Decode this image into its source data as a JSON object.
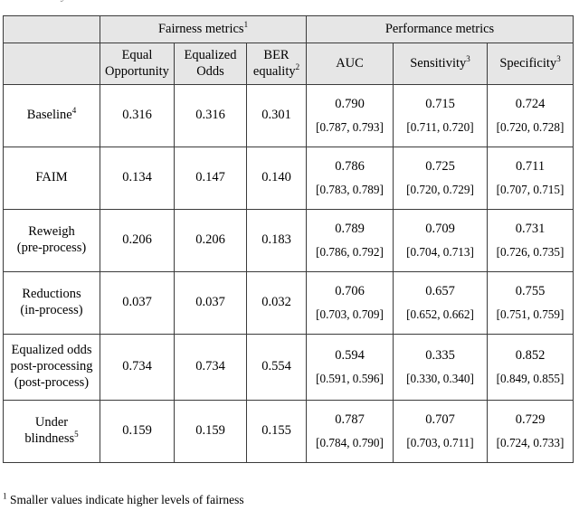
{
  "page": {
    "clipped_text_above": "y",
    "footnote": {
      "marker": "1",
      "text": "Smaller values indicate higher levels of fairness"
    },
    "colors": {
      "header_fill": "#e6e6e6",
      "border": "#3b3b3b",
      "text": "#000000",
      "background": "#ffffff"
    }
  },
  "table": {
    "group_headers": [
      {
        "label": "",
        "marker": ""
      },
      {
        "label": "Fairness metrics",
        "marker": "1",
        "span": 3
      },
      {
        "label": "Performance metrics",
        "marker": "",
        "span": 3
      }
    ],
    "column_headers": [
      {
        "line1": "",
        "line2": "",
        "marker": ""
      },
      {
        "line1": "Equal",
        "line2": "Opportunity",
        "marker": ""
      },
      {
        "line1": "Equalized",
        "line2": "Odds",
        "marker": ""
      },
      {
        "line1": "BER",
        "line2": "equality",
        "marker": "2"
      },
      {
        "line1": "AUC",
        "line2": "",
        "marker": ""
      },
      {
        "line1": "Sensitivity",
        "line2": "",
        "marker": "3"
      },
      {
        "line1": "Specificity",
        "line2": "",
        "marker": "3"
      }
    ],
    "rows": [
      {
        "label_lines": [
          "Baseline"
        ],
        "label_marker": "4",
        "equal_opportunity": "0.316",
        "equalized_odds": "0.316",
        "ber_equality": "0.301",
        "auc": {
          "point": "0.790",
          "ci": "[0.787, 0.793]"
        },
        "sensitivity": {
          "point": "0.715",
          "ci": "[0.711, 0.720]"
        },
        "specificity": {
          "point": "0.724",
          "ci": "[0.720, 0.728]"
        }
      },
      {
        "label_lines": [
          "FAIM"
        ],
        "label_marker": "",
        "equal_opportunity": "0.134",
        "equalized_odds": "0.147",
        "ber_equality": "0.140",
        "auc": {
          "point": "0.786",
          "ci": "[0.783, 0.789]"
        },
        "sensitivity": {
          "point": "0.725",
          "ci": "[0.720, 0.729]"
        },
        "specificity": {
          "point": "0.711",
          "ci": "[0.707, 0.715]"
        }
      },
      {
        "label_lines": [
          "Reweigh",
          "(pre-process)"
        ],
        "label_marker": "",
        "equal_opportunity": "0.206",
        "equalized_odds": "0.206",
        "ber_equality": "0.183",
        "auc": {
          "point": "0.789",
          "ci": "[0.786, 0.792]"
        },
        "sensitivity": {
          "point": "0.709",
          "ci": "[0.704, 0.713]"
        },
        "specificity": {
          "point": "0.731",
          "ci": "[0.726, 0.735]"
        }
      },
      {
        "label_lines": [
          "Reductions",
          "(in-process)"
        ],
        "label_marker": "",
        "equal_opportunity": "0.037",
        "equalized_odds": "0.037",
        "ber_equality": "0.032",
        "auc": {
          "point": "0.706",
          "ci": "[0.703, 0.709]"
        },
        "sensitivity": {
          "point": "0.657",
          "ci": "[0.652, 0.662]"
        },
        "specificity": {
          "point": "0.755",
          "ci": "[0.751, 0.759]"
        }
      },
      {
        "label_lines": [
          "Equalized odds",
          "post-processing",
          "(post-process)"
        ],
        "label_marker": "",
        "equal_opportunity": "0.734",
        "equalized_odds": "0.734",
        "ber_equality": "0.554",
        "auc": {
          "point": "0.594",
          "ci": "[0.591, 0.596]"
        },
        "sensitivity": {
          "point": "0.335",
          "ci": "[0.330, 0.340]"
        },
        "specificity": {
          "point": "0.852",
          "ci": "[0.849, 0.855]"
        }
      },
      {
        "label_lines": [
          "Under",
          "blindness"
        ],
        "label_marker": "5",
        "equal_opportunity": "0.159",
        "equalized_odds": "0.159",
        "ber_equality": "0.155",
        "auc": {
          "point": "0.787",
          "ci": "[0.784, 0.790]"
        },
        "sensitivity": {
          "point": "0.707",
          "ci": "[0.703, 0.711]"
        },
        "specificity": {
          "point": "0.729",
          "ci": "[0.724, 0.733]"
        }
      }
    ]
  }
}
